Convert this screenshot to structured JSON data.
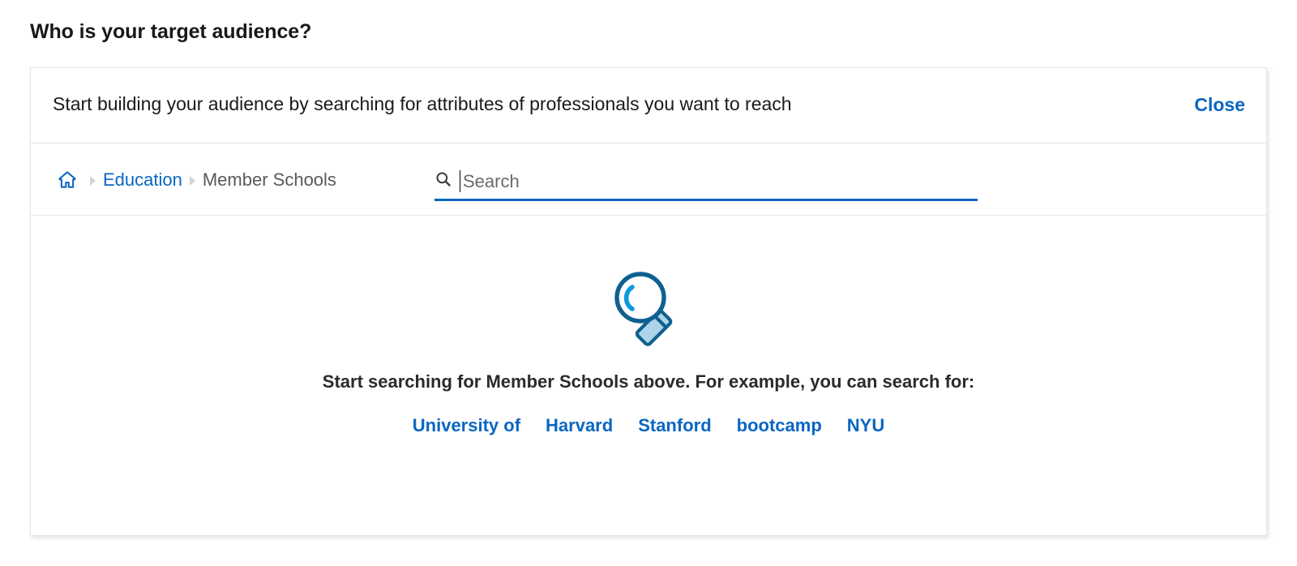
{
  "page": {
    "title": "Who is your target audience?"
  },
  "card": {
    "header": {
      "description": "Start building your audience by searching for attributes of professionals you want to reach",
      "close_label": "Close"
    },
    "breadcrumb": {
      "home_icon": "home-icon",
      "separator_icon": "chevron-right-icon",
      "items": [
        {
          "label": "Education",
          "current": false
        },
        {
          "label": "Member Schools",
          "current": true
        }
      ]
    },
    "search": {
      "icon": "search-icon",
      "value": "",
      "placeholder": "Search"
    },
    "empty_state": {
      "illustration": "magnifying-glass-illustration",
      "hint": "Start searching for Member Schools above. For example, you can search for:",
      "suggestions": [
        "University of",
        "Harvard",
        "Stanford",
        "bootcamp",
        "NYU"
      ]
    }
  },
  "colors": {
    "link_blue": "#0a66c2",
    "text_dark": "#1a1a1a",
    "text_muted": "#595959",
    "border": "#e6e6e6",
    "illustration_dark": "#10608f",
    "illustration_light": "#0d9ae0",
    "illustration_fill": "#aed4ea"
  }
}
